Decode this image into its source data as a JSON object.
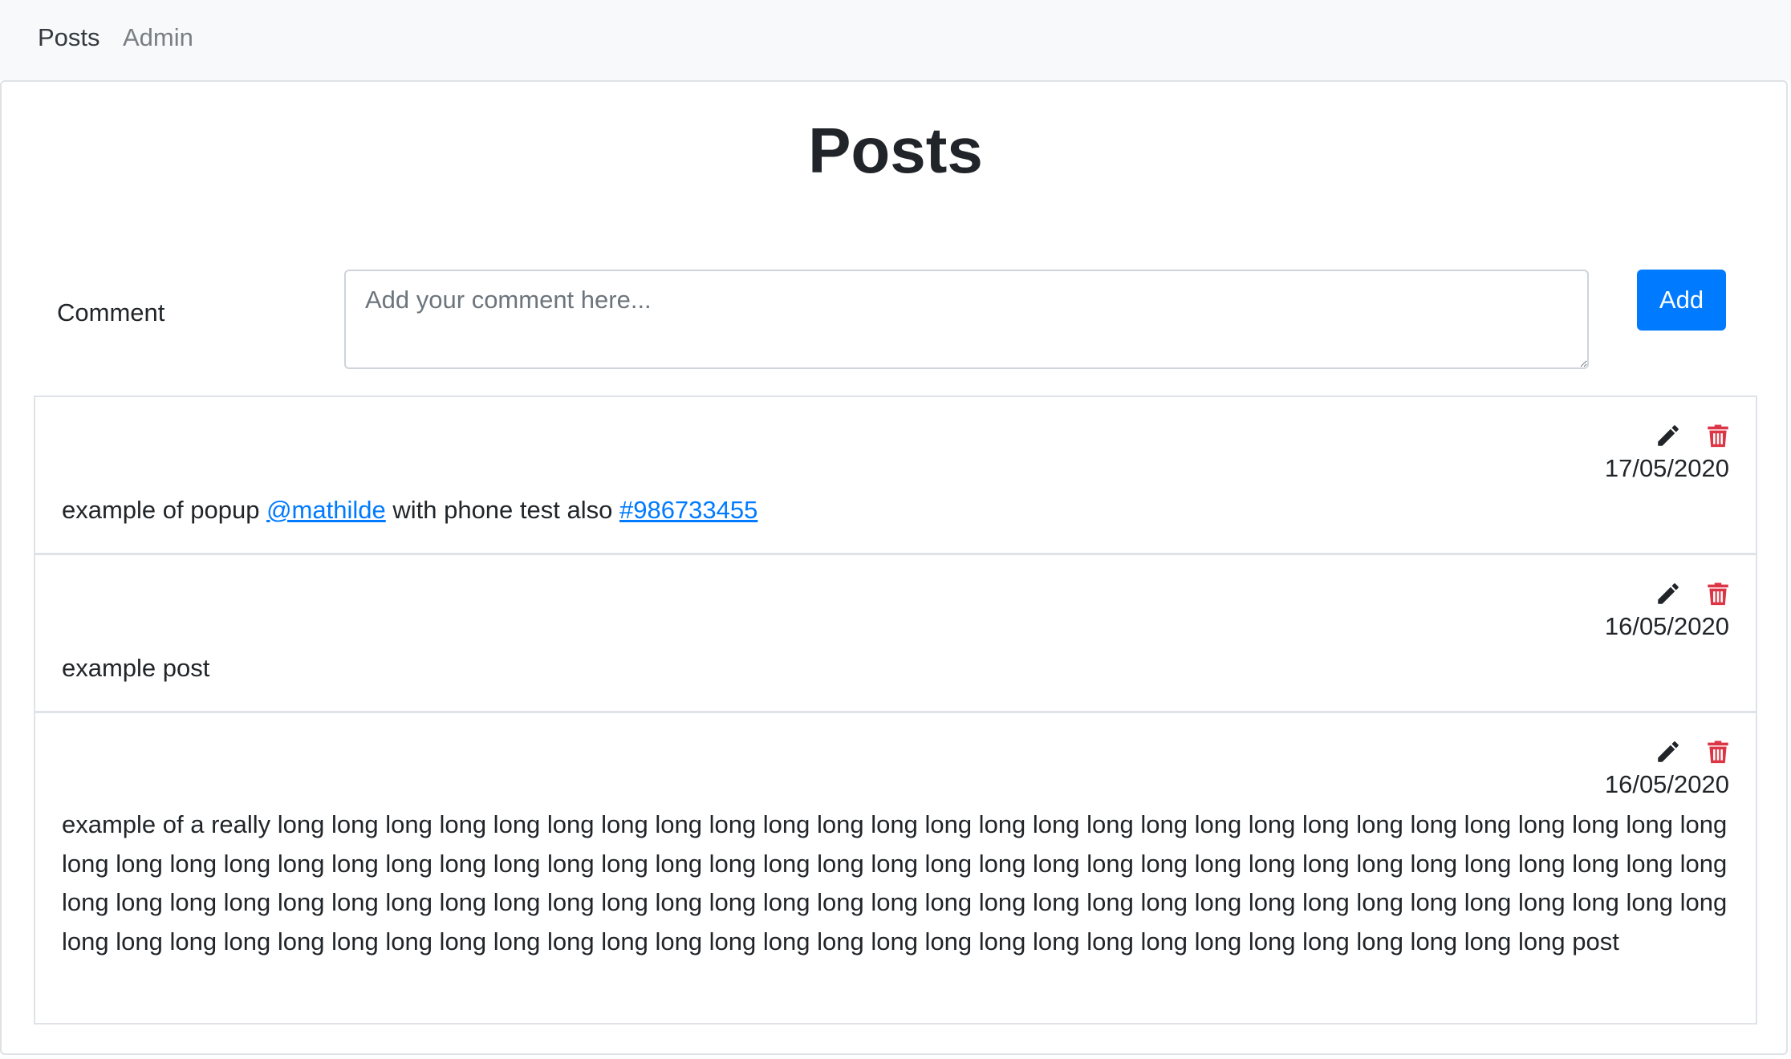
{
  "nav": {
    "items": [
      {
        "label": "Posts"
      },
      {
        "label": "Admin"
      }
    ]
  },
  "page": {
    "title": "Posts"
  },
  "form": {
    "label": "Comment",
    "placeholder": "Add your comment here...",
    "value": "",
    "add_label": "Add"
  },
  "colors": {
    "accent": "#007bff",
    "danger": "#dc3545",
    "navbar_bg": "#f8f9fa"
  },
  "icons": {
    "edit": "pencil-icon",
    "delete": "trash-icon"
  },
  "posts": [
    {
      "date": "17/05/2020",
      "text_before_mention": "example of popup ",
      "mention": "@mathilde",
      "text_middle": " with phone test also ",
      "hashtag": "#986733455"
    },
    {
      "date": "16/05/2020",
      "text": "example post"
    },
    {
      "date": "16/05/2020",
      "text": "example of a really long long long long long long long long long long long long long long long long long long long long long long long long long long long long long long long long long long long long long long long long long long long long long long long long long long long long long long long long long long long long long long long long long long long long long long long long long long long long long long long long long long long long long long long long long long long long long long long long long long long long long long long long long long long long long long long long long long long long long post"
    }
  ]
}
